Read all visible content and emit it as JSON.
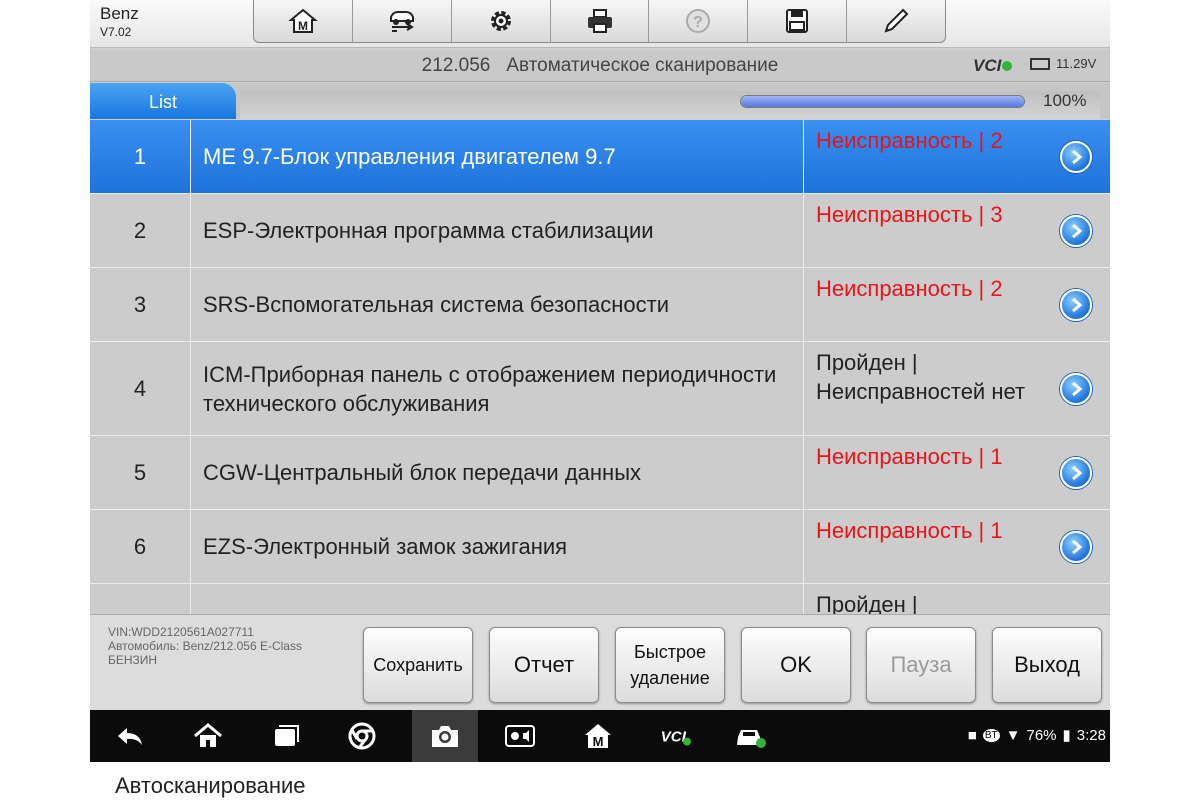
{
  "app": {
    "name": "Benz",
    "version": "V7.02"
  },
  "toolbar": {
    "items": [
      {
        "icon": "home-icon"
      },
      {
        "icon": "vehicle-swap-icon"
      },
      {
        "icon": "gear-icon"
      },
      {
        "icon": "printer-icon"
      },
      {
        "icon": "help-icon"
      },
      {
        "icon": "save-icon"
      },
      {
        "icon": "pen-icon"
      }
    ]
  },
  "header": {
    "code": "212.056",
    "title": "Автоматическое сканирование",
    "vci_label": "VCI",
    "voltage": "11.29V"
  },
  "tab": {
    "label": "List"
  },
  "progress": {
    "value": 100,
    "label": "100%"
  },
  "list": {
    "rows": [
      {
        "num": "1",
        "name": "ME 9.7-Блок управления двигателем 9.7",
        "status": "Неисправность | 2",
        "state": "fault",
        "selected": true
      },
      {
        "num": "2",
        "name": "ESP-Электронная программа стабилизации",
        "status": "Неисправность | 3",
        "state": "fault",
        "selected": false
      },
      {
        "num": "3",
        "name": "SRS-Вспомогательная система безопасности",
        "status": "Неисправность | 2",
        "state": "fault",
        "selected": false
      },
      {
        "num": "4",
        "name": "ICM-Приборная панель с отображением периодичности технического обслуживания",
        "status": "Пройден | Неисправностей нет",
        "state": "ok",
        "selected": false
      },
      {
        "num": "5",
        "name": "CGW-Центральный блок передачи данных",
        "status": "Неисправность | 1",
        "state": "fault",
        "selected": false
      },
      {
        "num": "6",
        "name": "EZS-Электронный замок зажигания",
        "status": "Неисправность | 1",
        "state": "fault",
        "selected": false
      },
      {
        "num": "",
        "name": "",
        "status": "Пройден |",
        "state": "ok",
        "selected": false
      }
    ]
  },
  "vehicle": {
    "vin": "VIN:WDD2120561A027711",
    "model": "Автомобиль: Benz/212.056 E-Class БЕНЗИН"
  },
  "buttons": {
    "save": "Сохранить",
    "report": "Отчет",
    "quick_erase": "Быстрое удаление",
    "ok": "OK",
    "pause": "Пауза",
    "exit": "Выход"
  },
  "statusbar": {
    "bt": "BT",
    "battery": "76%",
    "time": "3:28",
    "vci_label": "VCI"
  },
  "caption": "Автосканирование",
  "colors": {
    "accent": "#1e73db",
    "fault": "#e8141a",
    "ok_badge": "#35b238"
  }
}
